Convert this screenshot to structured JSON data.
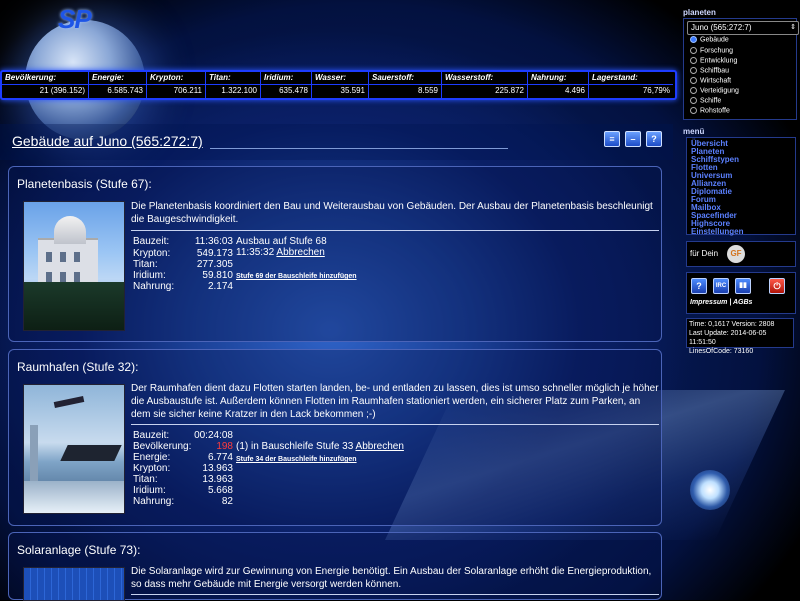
{
  "app": {
    "logo": "SP"
  },
  "resources": [
    {
      "label": "Bevölkerung:",
      "value": "21 (396.152)"
    },
    {
      "label": "Energie:",
      "value": "6.585.743"
    },
    {
      "label": "Krypton:",
      "value": "706.211"
    },
    {
      "label": "Titan:",
      "value": "1.322.100"
    },
    {
      "label": "Iridium:",
      "value": "635.478"
    },
    {
      "label": "Wasser:",
      "value": "35.591"
    },
    {
      "label": "Sauerstoff:",
      "value": "8.559"
    },
    {
      "label": "Wasserstoff:",
      "value": "225.872"
    },
    {
      "label": "Nahrung:",
      "value": "4.496"
    },
    {
      "label": "Lagerstand:",
      "value": "76,79%"
    }
  ],
  "planets": {
    "title": "planeten",
    "selected": "Juno (565:272:7)",
    "options": [
      "Gebäude",
      "Forschung",
      "Entwicklung",
      "Schiffbau",
      "Wirtschaft",
      "Verteidigung",
      "Schiffe",
      "Rohstoffe"
    ],
    "active_index": 0
  },
  "menu": {
    "title": "menü",
    "items": [
      "Übersicht",
      "Planeten",
      "Schiffstypen",
      "Flotten",
      "Universum",
      "Allianzen",
      "Diplomatie",
      "Forum",
      "Mailbox",
      "Spacefinder",
      "Highscore",
      "Einstellungen"
    ]
  },
  "gf": {
    "label": "für Dein",
    "logo": "GF"
  },
  "side_buttons": {
    "help": "?",
    "irc": "IRC",
    "stats": "▮▮",
    "power": "⏻"
  },
  "impressum": {
    "a": "Impressum",
    "sep": "|",
    "b": "AGBs"
  },
  "stats": {
    "line1": "Time: 0,1617 Version: 2808",
    "line2": "Last Update: 2014-06-05 11:51:50",
    "line3": "LinesOfCode: 73160"
  },
  "page": {
    "title": "Gebäude auf Juno (565:272:7)",
    "btn_list": "≡",
    "btn_min": "–",
    "btn_help": "?"
  },
  "buildings": [
    {
      "title": "Planetenbasis (Stufe 67):",
      "desc": "Die Planetenbasis koordiniert den Bau und Weiterausbau von Gebäuden. Der Ausbau der Planetenbasis beschleunigt die Baugeschwindigkeit.",
      "costs": [
        {
          "k": "Bauzeit:",
          "v": "11:36:03"
        },
        {
          "k": "Krypton:",
          "v": "549.173"
        },
        {
          "k": "Titan:",
          "v": "277.305"
        },
        {
          "k": "Iridium:",
          "v": "59.810"
        },
        {
          "k": "Nahrung:",
          "v": "2.174"
        }
      ],
      "info1": "Ausbau auf Stufe 68",
      "info2_prefix": "11:35:32",
      "info2_link": "Abbrechen",
      "queue": "Stufe 69 der Bauschleife hinzufügen"
    },
    {
      "title": "Raumhafen (Stufe 32):",
      "desc": "Der Raumhafen dient dazu Flotten starten landen, be- und entladen zu lassen, dies ist umso schneller möglich je höher die Ausbaustufe ist. Außerdem können Flotten im Raumhafen stationiert werden, ein sicherer Platz zum Parken, an dem sie sicher keine Kratzer in den Lack bekommen ;-)",
      "costs": [
        {
          "k": "Bauzeit:",
          "v": "00:24:08"
        },
        {
          "k": "Bevölkerung:",
          "v": "198"
        },
        {
          "k": "Energie:",
          "v": "6.774"
        },
        {
          "k": "Krypton:",
          "v": "13.963"
        },
        {
          "k": "Titan:",
          "v": "13.963"
        },
        {
          "k": "Iridium:",
          "v": "5.668"
        },
        {
          "k": "Nahrung:",
          "v": "82"
        }
      ],
      "info1_prefix": "(1) in Bauschleife Stufe 33",
      "info1_link": "Abbrechen",
      "queue": "Stufe 34 der Bauschleife hinzufügen"
    },
    {
      "title": "Solaranlage (Stufe 73):",
      "desc": "Die Solaranlage wird zur Gewinnung von Energie benötigt. Ein Ausbau der Solaranlage erhöht die Energieproduktion, so dass mehr Gebäude mit Energie versorgt werden können."
    }
  ],
  "colors": {
    "accent": "#1d3cff",
    "menu_link": "#5b80ff",
    "warning": "#ff3b3b"
  }
}
